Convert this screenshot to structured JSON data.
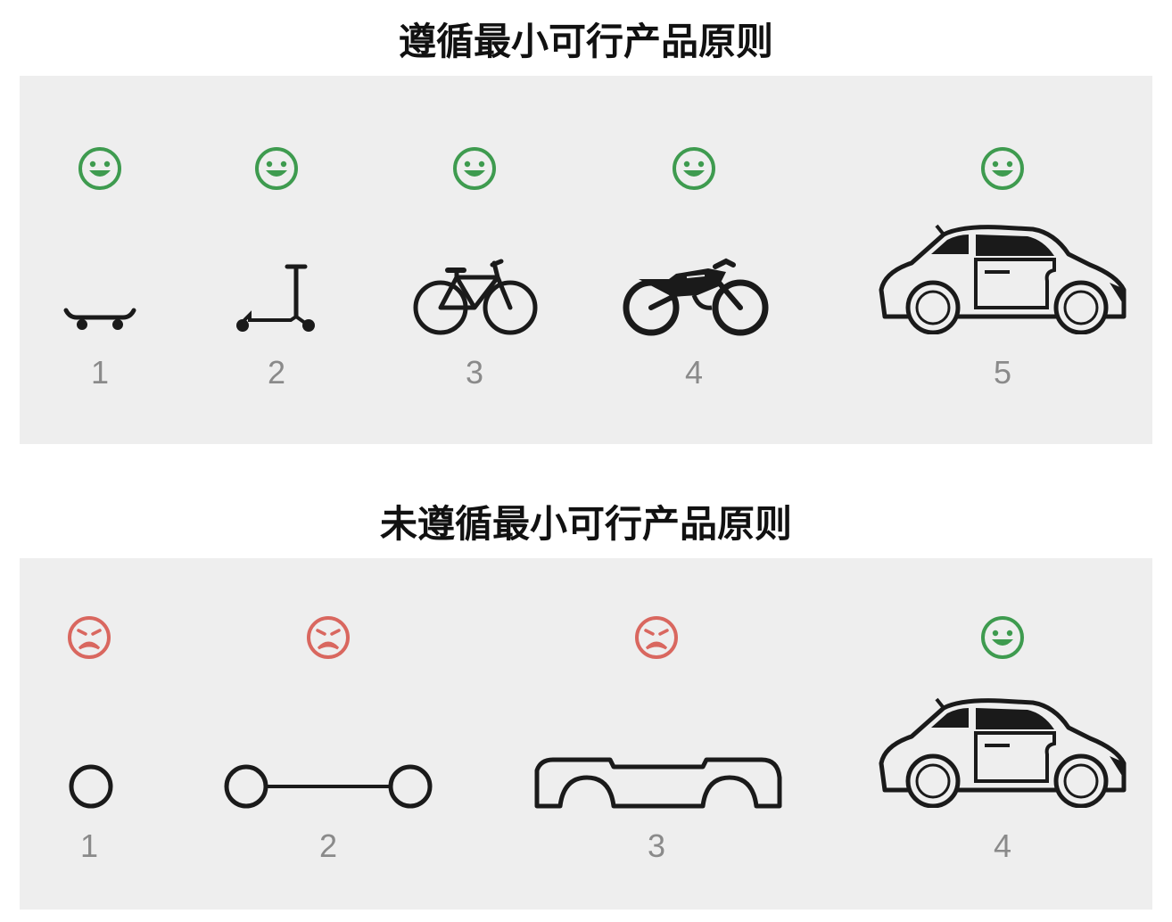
{
  "colors": {
    "happy": "#3e9b4f",
    "sad": "#d9675f",
    "panel": "#eeeeee",
    "ink": "#1a1a1a",
    "number": "#8a8a8a"
  },
  "follow": {
    "title": "遵循最小可行产品原则",
    "steps": [
      {
        "label": "1",
        "mood": "happy",
        "vehicle": "skateboard-icon"
      },
      {
        "label": "2",
        "mood": "happy",
        "vehicle": "scooter-icon"
      },
      {
        "label": "3",
        "mood": "happy",
        "vehicle": "bicycle-icon"
      },
      {
        "label": "4",
        "mood": "happy",
        "vehicle": "motorcycle-icon"
      },
      {
        "label": "5",
        "mood": "happy",
        "vehicle": "car-icon"
      }
    ]
  },
  "not_follow": {
    "title": "未遵循最小可行产品原则",
    "steps": [
      {
        "label": "1",
        "mood": "sad",
        "vehicle": "wheel-icon"
      },
      {
        "label": "2",
        "mood": "sad",
        "vehicle": "axle-icon"
      },
      {
        "label": "3",
        "mood": "sad",
        "vehicle": "chassis-icon"
      },
      {
        "label": "4",
        "mood": "happy",
        "vehicle": "car-icon"
      }
    ]
  }
}
